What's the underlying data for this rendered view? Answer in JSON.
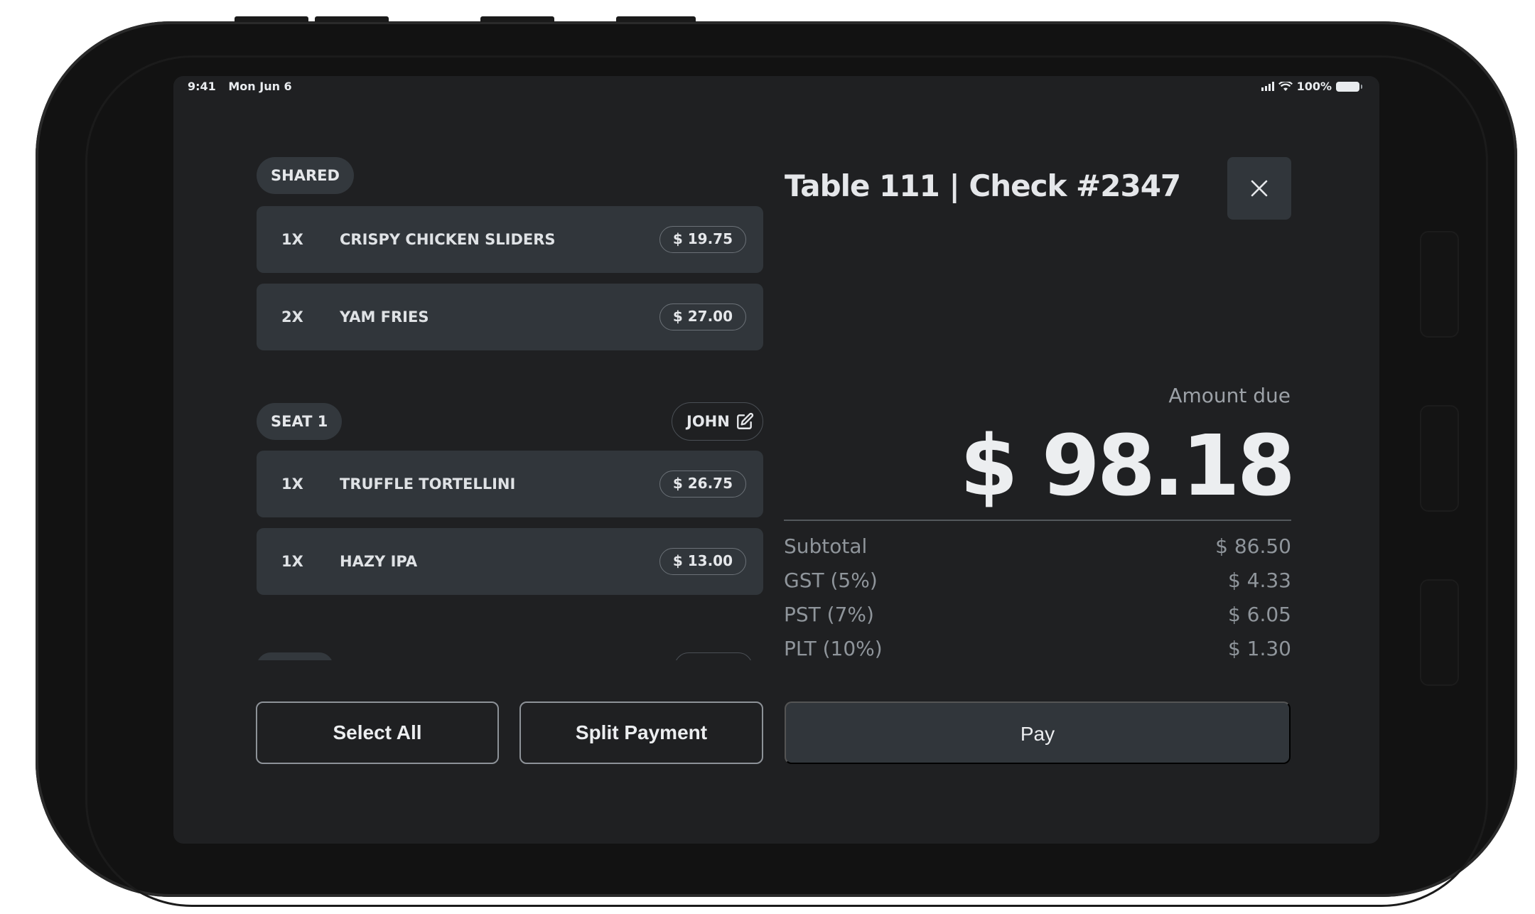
{
  "status_bar": {
    "time": "9:41",
    "date": "Mon Jun 6",
    "battery": "100%"
  },
  "order": {
    "groups": [
      {
        "label": "SHARED",
        "items": [
          {
            "qty": "1X",
            "name": "CRISPY CHICKEN SLIDERS",
            "price": "$ 19.75"
          },
          {
            "qty": "2X",
            "name": "YAM FRIES",
            "price": "$ 27.00"
          }
        ]
      },
      {
        "label": "SEAT 1",
        "guest_name": "JOHN",
        "items": [
          {
            "qty": "1X",
            "name": "TRUFFLE TORTELLINI",
            "price": "$ 26.75"
          },
          {
            "qty": "1X",
            "name": "HAZY IPA",
            "price": "$ 13.00"
          }
        ]
      }
    ]
  },
  "check": {
    "title": "Table 111 | Check #2347",
    "amount_due_label": "Amount due",
    "amount_due": "$ 98.18",
    "totals": [
      {
        "label": "Subtotal",
        "value": "$ 86.50"
      },
      {
        "label": "GST (5%)",
        "value": "$ 4.33"
      },
      {
        "label": "PST (7%)",
        "value": "$ 6.05"
      },
      {
        "label": "PLT (10%)",
        "value": "$ 1.30"
      }
    ]
  },
  "actions": {
    "select_all": "Select All",
    "split_payment": "Split Payment",
    "pay": "Pay"
  },
  "colors": {
    "background": "#1f2022",
    "card": "#31363b",
    "text": "#e5e7ea",
    "muted": "#8f959b"
  }
}
